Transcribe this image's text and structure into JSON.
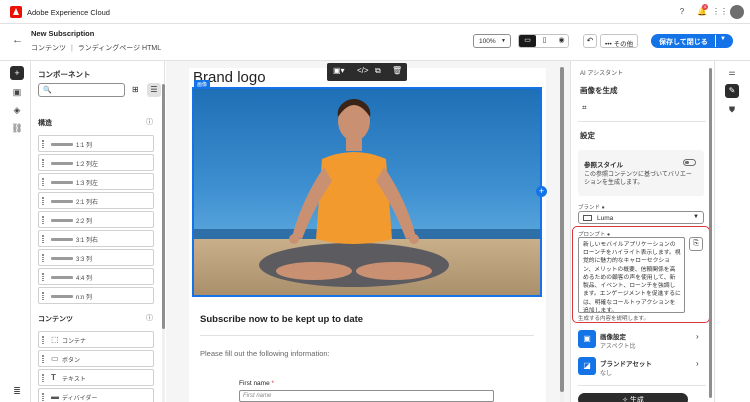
{
  "app": {
    "title": "Adobe Experience Cloud",
    "notification_count": "4"
  },
  "header": {
    "doc_title": "New Subscription",
    "breadcrumb_1": "コンテンツ",
    "breadcrumb_sep": "|",
    "breadcrumb_2": "ランディングページ HTML",
    "zoom": "100%",
    "more_label": "その他",
    "save_label": "保存して閉じる"
  },
  "left_panel": {
    "title": "コンポーネント",
    "structure_header": "構造",
    "structures": [
      "1:1 列",
      "1:2 列左",
      "1:3 列左",
      "2:1 列右",
      "2:2 列",
      "3:1 列右",
      "3:3 列",
      "4:4 列",
      "n:n 列"
    ],
    "content_header": "コンテンツ",
    "contents": [
      "コンテナ",
      "ボタン",
      "テキスト",
      "ディバイダー"
    ]
  },
  "canvas": {
    "brand_logo": "Brand logo",
    "image_tag": "画像",
    "subscribe_heading": "Subscribe now to be kept up to date",
    "fill_text": "Please fill out the following information:",
    "first_name_label": "First name",
    "required_mark": "*",
    "first_name_placeholder": "First name"
  },
  "right_panel": {
    "ai_header": "AI アシスタント",
    "generate_title": "画像を生成",
    "settings_title": "設定",
    "ref_style_title": "参照スタイル",
    "ref_style_desc": "この参照コンテンツに基づいてバリエーションを生成します。",
    "brand_label": "ブランド ●",
    "brand_value": "Luma",
    "prompt_label": "プロンプト ●",
    "prompt_text": "新しいモバイルアプリケーションのローンチをハイライト表示します。視覚的に魅力的なキャローセクション、メリットの概要、信頼関係を高めるための顧客の声を使用して、新製品、イベント、ローンチを強調します。エンゲージメントを促進するには、明確なコールトゥアクションを追加します。",
    "prompt_help": "生成する内容を説明します。",
    "image_settings_title": "画像設定",
    "image_settings_sub": "アスペクト比",
    "brand_assets_title": "ブランドアセット",
    "brand_assets_sub": "なし",
    "generate_button": "生成"
  },
  "colors": {
    "accent": "#1473e6",
    "highlight": "#d7373f",
    "dark": "#2c2c2c",
    "brand": "#eb1000"
  }
}
